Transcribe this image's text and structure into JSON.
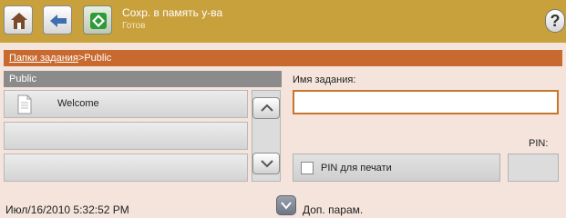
{
  "status_bar": {
    "title": "Сохр. в память у-ва",
    "subtitle": "Готов",
    "help_label": "?"
  },
  "breadcrumb": {
    "parent": "Папки задания",
    "separator": ">",
    "current": "Public"
  },
  "folder_list": {
    "header": "Public",
    "items": [
      {
        "label": "Welcome",
        "icon": "document-icon"
      },
      {
        "label": ""
      },
      {
        "label": ""
      }
    ]
  },
  "form": {
    "job_name_label": "Имя задания:",
    "job_name_value": "",
    "pin_label": "PIN:",
    "pin_checkbox_label": "PIN для печати",
    "pin_value": ""
  },
  "footer": {
    "datetime": "Июл/16/2010 5:32:52 PM",
    "more_options_label": "Доп. парам."
  },
  "colors": {
    "status_bar": "#c8a03c",
    "breadcrumb": "#c86a30",
    "list_header": "#8b8b8b",
    "input_border": "#c8752e",
    "background": "#f4e4dc"
  }
}
